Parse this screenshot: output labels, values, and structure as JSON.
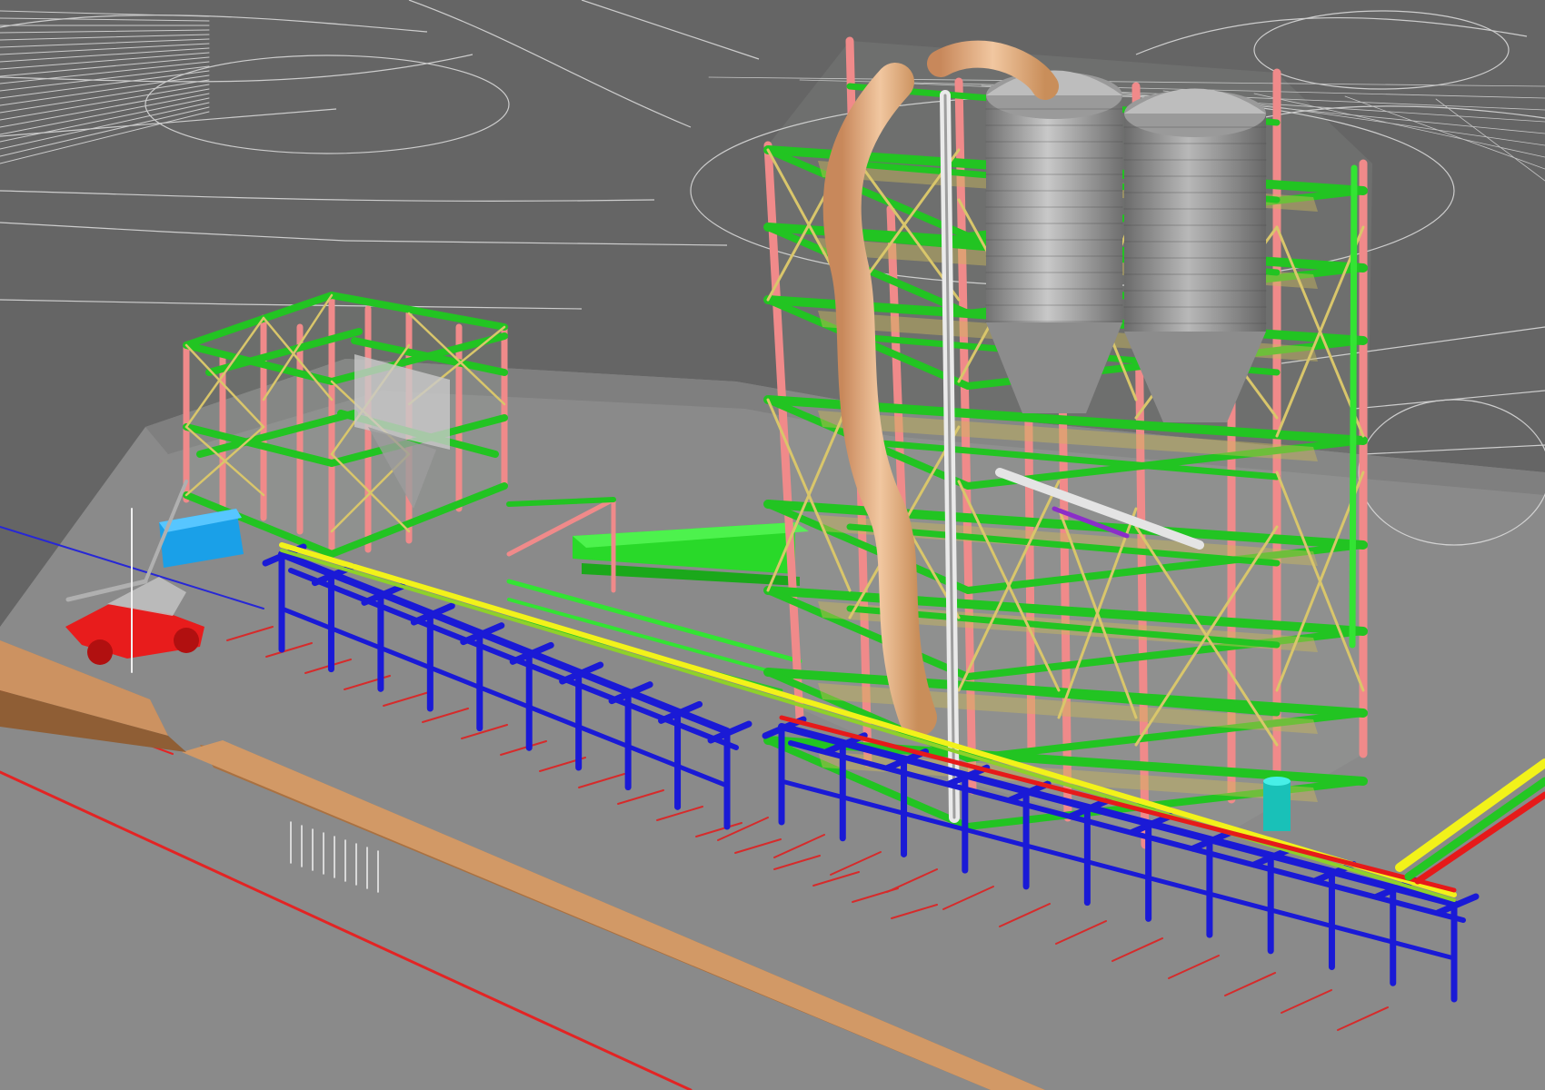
{
  "viewport": {
    "background": "#656565",
    "ground_slab": "#8a8a8a",
    "drawing_lines": "#d9d9d9"
  },
  "colors": {
    "columns": "#f08a8a",
    "beams": "#22c422",
    "bracing": "#d9c66b",
    "pipe_rack": "#1a1ad6",
    "silo": "#9a9a9a",
    "duct": "#e8b98a",
    "berm": "#c98e5a",
    "conveyor": "#33e433",
    "vehicle": "#e81c1c",
    "equipment": "#1aa0e8",
    "pipe_yellow": "#f2f21a",
    "pipe_red": "#e61a1a",
    "pipe_green": "#23c723"
  },
  "objects": [
    "ground-slab",
    "cad-linework",
    "earth-berm",
    "storage-silo",
    "cyclone-duct",
    "main-tower-structure",
    "small-structure",
    "conveyor-gallery",
    "pipe-rack",
    "utility-vehicle",
    "equipment-skid"
  ]
}
